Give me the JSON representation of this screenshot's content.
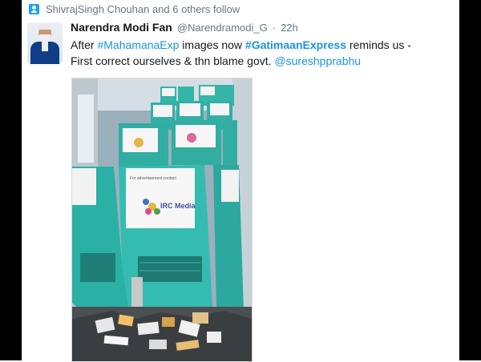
{
  "context": {
    "text": "ShivrajSingh Chouhan and 6 others follow",
    "icon": "follow-icon"
  },
  "tweet": {
    "author_name": "Narendra Modi Fan",
    "author_handle": "@Narendramodi_G",
    "separator": "·",
    "time": "22h",
    "text": {
      "t1": "After ",
      "h1": "#MahamanaExp",
      "t2": " images now ",
      "h2": "#GatimaanExpress",
      "t3": " reminds us - First correct ourselves & thn blame govt. ",
      "mention": "@sureshpprabhu"
    },
    "photo": {
      "seat_card_text": "IRC Media",
      "seat_card_caption": "For advertisement contact"
    }
  },
  "colors": {
    "link": "#1b95e0",
    "meta": "#657786",
    "seat": "#2fb1a7"
  }
}
